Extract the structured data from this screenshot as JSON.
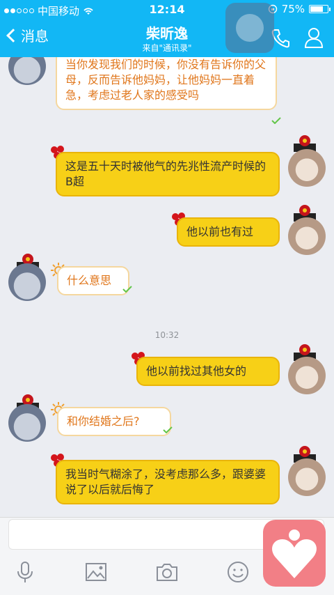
{
  "status_bar": {
    "carrier": "中国移动",
    "time": "12:14",
    "battery_percent": "75%",
    "battery_level": 0.75
  },
  "nav": {
    "back_label": "消息",
    "title": "柴昕逸",
    "subtitle": "来自\"通讯录\""
  },
  "messages": [
    {
      "side": "in",
      "text": "当你发现我们的时候，你没有告诉你的父母，反而告诉他妈妈，让他妈妈一直着急，考虑过老人家的感受吗"
    },
    {
      "side": "out",
      "text": "这是五十天时被他气的先兆性流产时候的B超"
    },
    {
      "side": "out",
      "text": "他以前也有过"
    },
    {
      "side": "in",
      "text": "什么意思"
    },
    {
      "side": "out",
      "text": "他以前找过其他女的"
    },
    {
      "side": "in",
      "text": "和你结婚之后?"
    },
    {
      "side": "out",
      "text": "我当时气糊涂了，没考虑那么多，跟婆婆说了以后就后悔了"
    }
  ],
  "timestamp": "10:32",
  "colors": {
    "accent": "#12b7f5",
    "outgoing_bubble": "#f7d017",
    "incoming_text": "#e0761b"
  },
  "toolbar_icons": [
    "microphone-icon",
    "image-icon",
    "camera-icon",
    "emoji-icon"
  ]
}
